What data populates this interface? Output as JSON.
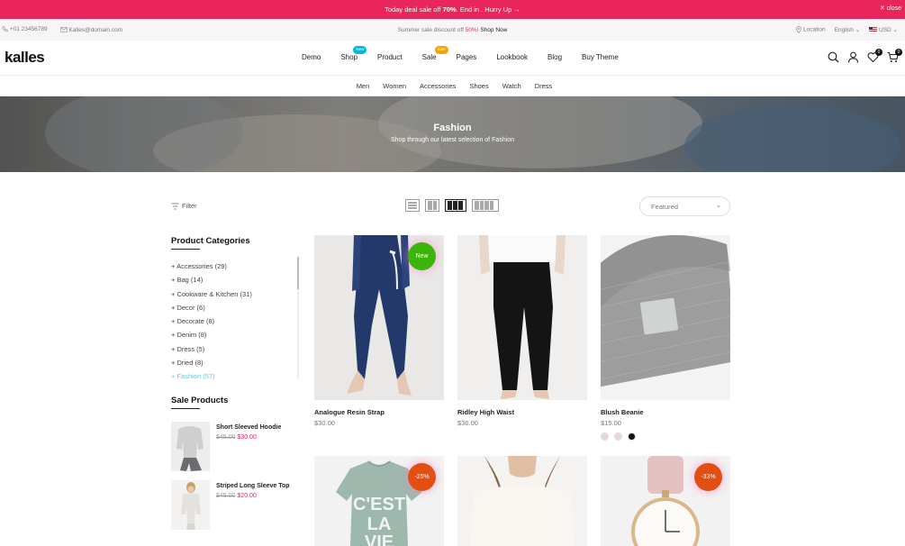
{
  "announcement": {
    "pre": "Today deal sale off ",
    "percent": "70%",
    "post": ". End in . Hurry Up",
    "arrow": "→",
    "close_label": "close"
  },
  "infobar": {
    "phone": "+01 23456789",
    "email": "Kalles@domain.com",
    "promo_pre": "Summer sale discount off ",
    "promo_percent": "50%",
    "promo_sep": "! ",
    "promo_link": "Shop Now",
    "location": "Location",
    "language": "English",
    "currency": "USD"
  },
  "header": {
    "logo": "kalles",
    "nav": [
      {
        "label": "Demo"
      },
      {
        "label": "Shop",
        "badge": "New",
        "badge_color": "#01bad4"
      },
      {
        "label": "Product"
      },
      {
        "label": "Sale",
        "badge": "Sale",
        "badge_color": "#f6a200"
      },
      {
        "label": "Pages"
      },
      {
        "label": "Lookbook"
      },
      {
        "label": "Blog"
      },
      {
        "label": "Buy Theme"
      }
    ],
    "wishlist_count": "0",
    "cart_count": "0"
  },
  "subnav": [
    "Men",
    "Women",
    "Accessories",
    "Shoes",
    "Watch",
    "Dress"
  ],
  "hero": {
    "title": "Fashion",
    "subtitle": "Shop through our latest selection of Fashion"
  },
  "toolbar": {
    "filter_label": "Filter",
    "sort_value": "Featured"
  },
  "sidebar": {
    "categories_title": "Product Categories",
    "categories": [
      {
        "label": "Accessories (29)"
      },
      {
        "label": "Bag (14)"
      },
      {
        "label": "Cookware & Kitchen (31)"
      },
      {
        "label": "Decor (6)"
      },
      {
        "label": "Decorate (8)"
      },
      {
        "label": "Denim (8)"
      },
      {
        "label": "Dress (5)"
      },
      {
        "label": "Dried (8)"
      },
      {
        "label": "Fashion (57)",
        "active": true
      }
    ],
    "sale_title": "Sale Products",
    "sale_items": [
      {
        "name": "Short Sleeved Hoodie",
        "old": "$45.00",
        "new": "$30.00"
      },
      {
        "name": "Striped Long Sleeve Top",
        "old": "$45.00",
        "new": "$20.00"
      }
    ]
  },
  "products": [
    {
      "name": "Analogue Resin Strap",
      "price": "$30.00",
      "label": "New",
      "label_color": "#3bb507"
    },
    {
      "name": "Ridley High Waist",
      "price": "$36.00"
    },
    {
      "name": "Blush Beanie",
      "price": "$15.00",
      "swatches": [
        "#e6d6d4",
        "#f1d3dc",
        "#111111"
      ]
    },
    {
      "name": "",
      "price": "",
      "label": "-25%",
      "label_color": "#e34f13"
    },
    {
      "name": "",
      "price": ""
    },
    {
      "name": "",
      "price": "",
      "label": "-33%",
      "label_color": "#e34f13"
    }
  ]
}
